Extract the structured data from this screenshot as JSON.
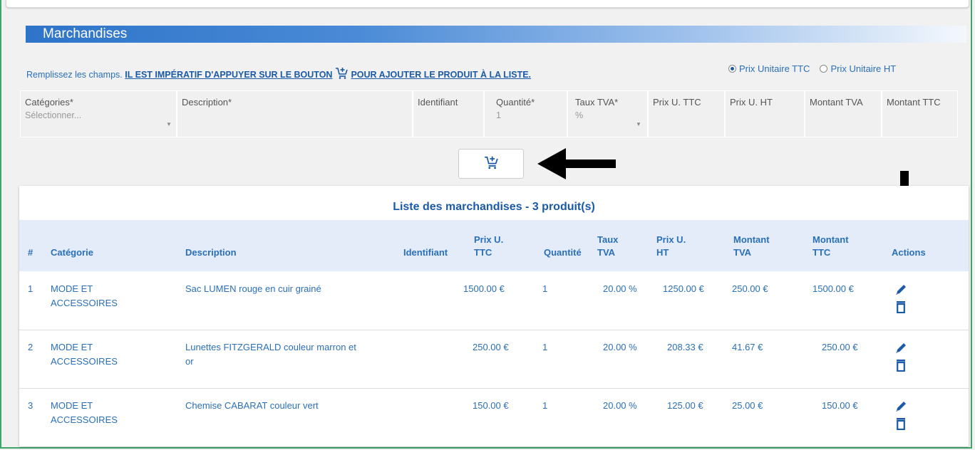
{
  "section": {
    "title": "Marchandises"
  },
  "instructions": {
    "prefix": "Remplissez les champs. ",
    "emphasis_a": "IL EST IMPÉRATIF D'APPUYER SUR LE BOUTON",
    "emphasis_b": "POUR AJOUTER LE PRODUIT À LA LISTE."
  },
  "price_mode": {
    "options": [
      {
        "label": "Prix Unitaire TTC",
        "selected": true
      },
      {
        "label": "Prix Unitaire HT",
        "selected": false
      }
    ]
  },
  "form": {
    "categories": {
      "label": "Catégories*",
      "placeholder": "Sélectionner..."
    },
    "description": {
      "label": "Description*"
    },
    "identifiant": {
      "label": "Identifiant"
    },
    "quantite": {
      "label": "Quantité*",
      "value": "1"
    },
    "taux_tva": {
      "label": "Taux TVA*",
      "value": "%"
    },
    "prix_ttc": {
      "label": "Prix U. TTC"
    },
    "prix_ht": {
      "label": "Prix U. HT"
    },
    "montant_tva": {
      "label": "Montant TVA"
    },
    "montant_ttc": {
      "label": "Montant TTC"
    }
  },
  "list": {
    "title": "Liste des marchandises - 3 produit(s)",
    "headers": {
      "num": "#",
      "categorie": "Catégorie",
      "description": "Description",
      "identifiant": "Identifiant",
      "prix_ttc_1": "Prix U.",
      "prix_ttc_2": "TTC",
      "quantite": "Quantité",
      "taux_1": "Taux",
      "taux_2": "TVA",
      "prix_ht_1": "Prix U.",
      "prix_ht_2": "HT",
      "mtva_1": "Montant",
      "mtva_2": "TVA",
      "mttc_1": "Montant",
      "mttc_2": "TTC",
      "actions": "Actions"
    },
    "rows": [
      {
        "num": "1",
        "cat_1": "MODE ET",
        "cat_2": "ACCESSOIRES",
        "desc_1": "Sac LUMEN rouge en cuir grainé",
        "desc_2": "",
        "prix_ttc": "1500.00 €",
        "quantite": "1",
        "taux": "20.00 %",
        "prix_ht": "1250.00 €",
        "mtva": "250.00 €",
        "mttc": "1500.00 €"
      },
      {
        "num": "2",
        "cat_1": "MODE ET",
        "cat_2": "ACCESSOIRES",
        "desc_1": "Lunettes FITZGERALD couleur marron et",
        "desc_2": "or",
        "prix_ttc": "250.00 €",
        "quantite": "1",
        "taux": "20.00 %",
        "prix_ht": "208.33 €",
        "mtva": "41.67 €",
        "mttc": "250.00 €"
      },
      {
        "num": "3",
        "cat_1": "MODE ET",
        "cat_2": "ACCESSOIRES",
        "desc_1": "Chemise CABARAT couleur vert",
        "desc_2": "",
        "prix_ttc": "150.00 €",
        "quantite": "1",
        "taux": "20.00 %",
        "prix_ht": "125.00 €",
        "mtva": "25.00 €",
        "mttc": "150.00 €"
      }
    ]
  },
  "icons": {
    "add_to_cart": "cart-plus-icon",
    "edit": "pencil-icon",
    "delete": "trash-icon",
    "annotations": "black-arrow-icon"
  },
  "colors": {
    "accent": "#2a6fb8",
    "header_bg": "#e3ecf8",
    "frame": "#3fa66a"
  }
}
